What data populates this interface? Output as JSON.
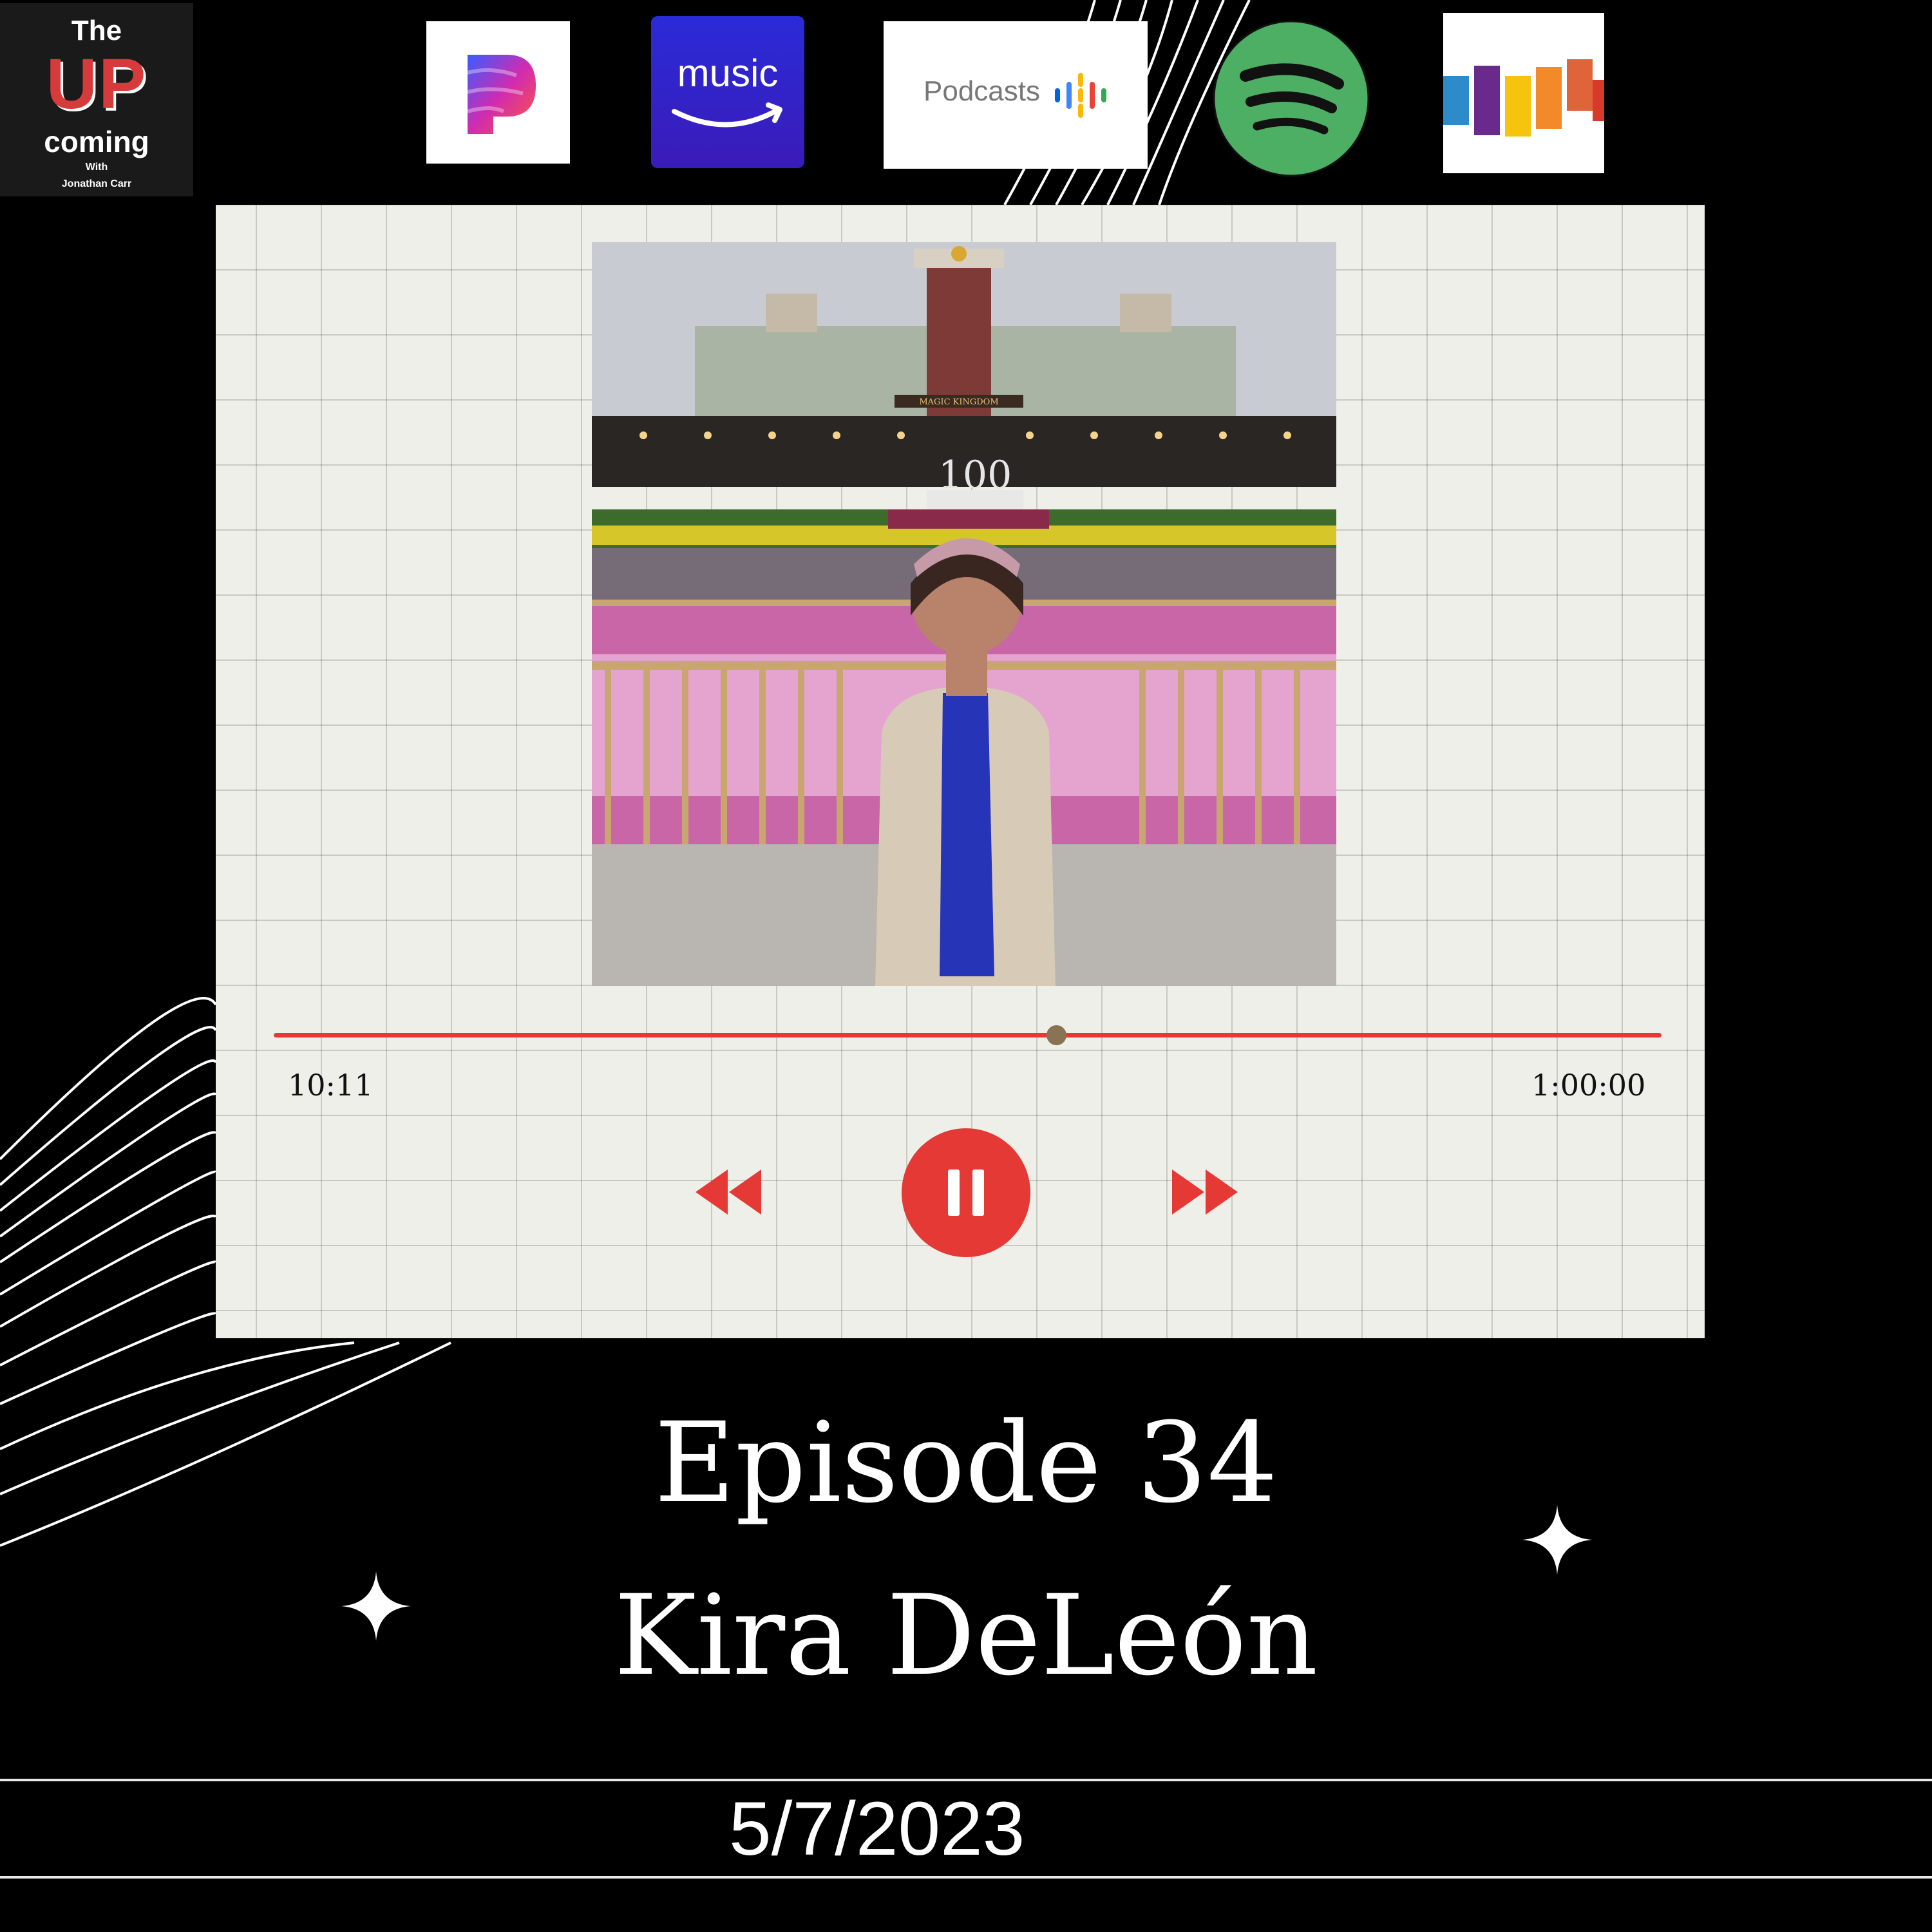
{
  "show_logo": {
    "line1": "The",
    "line2": "UP",
    "line3": "coming",
    "line4": "With",
    "line5": "Jonathan Carr"
  },
  "platforms": [
    {
      "name": "Pandora",
      "icon": "pandora-icon"
    },
    {
      "name": "Amazon Music",
      "icon": "amazon-music-icon",
      "label": "music"
    },
    {
      "name": "Google Podcasts",
      "icon": "google-podcasts-icon",
      "label": "Podcasts"
    },
    {
      "name": "Spotify",
      "icon": "spotify-icon"
    },
    {
      "name": "Deezer",
      "icon": "deezer-icon"
    }
  ],
  "player": {
    "elapsed": "10:11",
    "total": "1:00:00",
    "progress_fraction": 0.5,
    "state": "playing",
    "controls": [
      "rewind-icon",
      "pause-icon",
      "fast-forward-icon"
    ]
  },
  "episode": {
    "title": "Episode 34",
    "guest": "Kira DeLeón",
    "date": "5/7/2023"
  },
  "photo": {
    "sign_text": "MAGIC KINGDOM",
    "display_number": "100"
  },
  "colors": {
    "background": "#000000",
    "card": "#efefe9",
    "accent_red": "#e53935",
    "knob": "#8a7355",
    "text_light": "#ffffff"
  }
}
